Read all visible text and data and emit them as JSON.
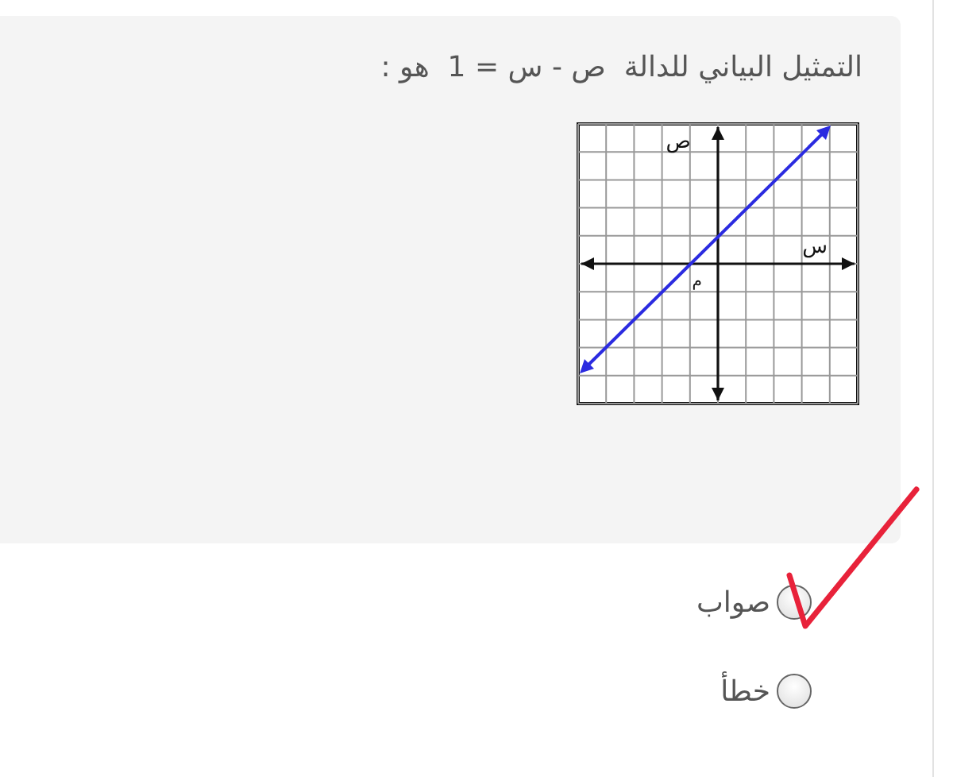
{
  "question": {
    "text": "التمثيل البياني للدالة  ص - س = 1  هو :",
    "graph": {
      "y_axis_label": "ص",
      "x_axis_label": "س",
      "origin_label": "م"
    }
  },
  "options": [
    {
      "label": "صواب",
      "selected": true
    },
    {
      "label": "خطأ",
      "selected": false
    }
  ]
}
